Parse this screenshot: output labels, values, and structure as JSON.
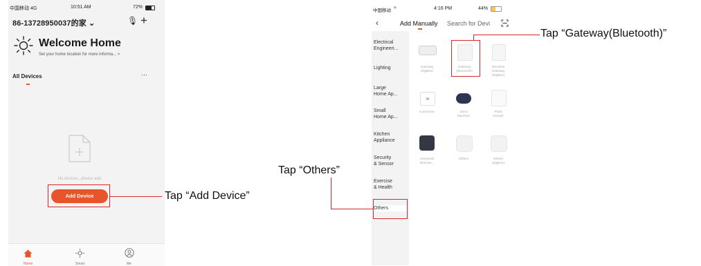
{
  "left": {
    "status": {
      "carrier": "中国移动  4G",
      "time": "10:51 AM",
      "battery": "72%"
    },
    "home_name": "86-13728950037的家 ⌄",
    "welcome": "Welcome Home",
    "subtitle": "Set your home location for more informa...  >",
    "tab_label": "All Devices",
    "more": "···",
    "empty_text": "No devices, please add",
    "add_button": "Add Device",
    "tabbar": [
      "Home",
      "Smart",
      "Me"
    ],
    "accent": "#e8552a"
  },
  "right": {
    "status": {
      "carrier": "中国移动",
      "time": "4:16 PM",
      "battery": "44%"
    },
    "tabs": {
      "manual": "Add Manually",
      "search": "Search for Devi"
    },
    "sidebar": [
      "Electrical\nEngineeri...",
      "Lighting",
      "Large\nHome Ap...",
      "Small\nHome Ap...",
      "Kitchen\nAppliance",
      "Security\n& Sensor",
      "Exercise\n& Health",
      "Others"
    ],
    "devices": [
      {
        "name": "Gateway\n(ZigBee)",
        "icon": "gateway-icon"
      },
      {
        "name": "Gateway\n(Bluetooth)",
        "icon": "gateway-icon"
      },
      {
        "name": "Wireless\nGateway\n(ZigBee)",
        "icon": "gateway-icon"
      },
      {
        "name": "Connector",
        "icon": "wifi-icon"
      },
      {
        "name": "Story\nMachine",
        "icon": "story-machine-icon"
      },
      {
        "name": "Plant\nGrower",
        "icon": "plant-icon"
      },
      {
        "name": "Universal\nRemote...",
        "icon": "remote-icon"
      },
      {
        "name": "Others",
        "icon": "box-icon"
      },
      {
        "name": "Others\n(ZigBee)",
        "icon": "box-icon"
      }
    ]
  },
  "callouts": {
    "add_device": "Tap “Add Device”",
    "others": "Tap “Others”",
    "gateway": "Tap “Gateway(Bluetooth)”",
    "line_color": "#d9262c"
  }
}
